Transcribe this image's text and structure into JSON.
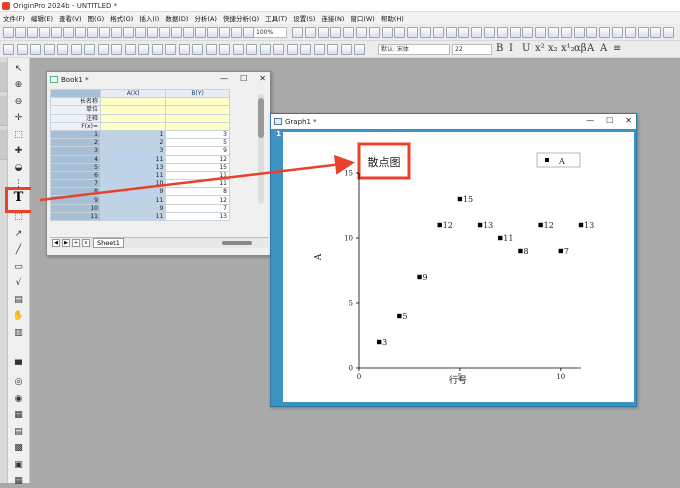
{
  "app": {
    "title": "OriginPro 2024b - UNTITLED *"
  },
  "menu": [
    "文件(F)",
    "编辑(E)",
    "查看(V)",
    "图(G)",
    "格式(O)",
    "插入(I)",
    "数据(D)",
    "分析(A)",
    "快捷分析(Q)",
    "工具(T)",
    "设置(S)",
    "连接(N)",
    "窗口(W)",
    "帮助(H)"
  ],
  "toolbar": {
    "zoom": "100%",
    "font_name": "默认: 宋体",
    "font_size": "22"
  },
  "format_buttons": [
    "B",
    "I",
    "U",
    "x²",
    "x₂",
    "x¹₂",
    "αβ",
    "A",
    "A",
    "≡"
  ],
  "book": {
    "title": "Book1 *",
    "col_headers": [
      "A(X)",
      "B(Y)"
    ],
    "meta_labels": [
      "长名称",
      "单位",
      "注释",
      "F(x)="
    ],
    "rows": [
      {
        "n": "1",
        "a": "1",
        "b": "3"
      },
      {
        "n": "2",
        "a": "2",
        "b": "5"
      },
      {
        "n": "3",
        "a": "3",
        "b": "9"
      },
      {
        "n": "4",
        "a": "11",
        "b": "12"
      },
      {
        "n": "5",
        "a": "13",
        "b": "15"
      },
      {
        "n": "6",
        "a": "11",
        "b": "11"
      },
      {
        "n": "7",
        "a": "10",
        "b": "11"
      },
      {
        "n": "8",
        "a": "9",
        "b": "8"
      },
      {
        "n": "9",
        "a": "11",
        "b": "12"
      },
      {
        "n": "10",
        "a": "9",
        "b": "7"
      },
      {
        "n": "11",
        "a": "11",
        "b": "13"
      }
    ],
    "sheet_tab": "Sheet1"
  },
  "graph": {
    "title": "Graph1 *",
    "layer_label": "1",
    "annotation": "散点图",
    "legend": "A",
    "xlabel": "行号",
    "ylabel": "A",
    "xticks": [
      "0",
      "5",
      "10"
    ],
    "yticks": [
      "0",
      "5",
      "10",
      "15"
    ]
  },
  "chart_data": {
    "type": "scatter",
    "title": "散点图",
    "xlabel": "行号",
    "ylabel": "A",
    "xlim": [
      0,
      11
    ],
    "ylim": [
      0,
      15
    ],
    "grid": false,
    "legend_position": "top-right",
    "series": [
      {
        "name": "A",
        "x": [
          1,
          2,
          3,
          4,
          5,
          6,
          7,
          8,
          9,
          10,
          11
        ],
        "y": [
          2,
          4,
          7,
          11,
          13,
          11,
          10,
          9,
          11,
          9,
          11
        ],
        "labels": [
          "3",
          "5",
          "9",
          "12",
          "15",
          "13",
          "11",
          "8",
          "12",
          "7",
          "13"
        ]
      }
    ]
  },
  "colors": {
    "highlight": "#e8412c",
    "graph_frame": "#3b93c2",
    "selected_column": "#bed3e7"
  }
}
